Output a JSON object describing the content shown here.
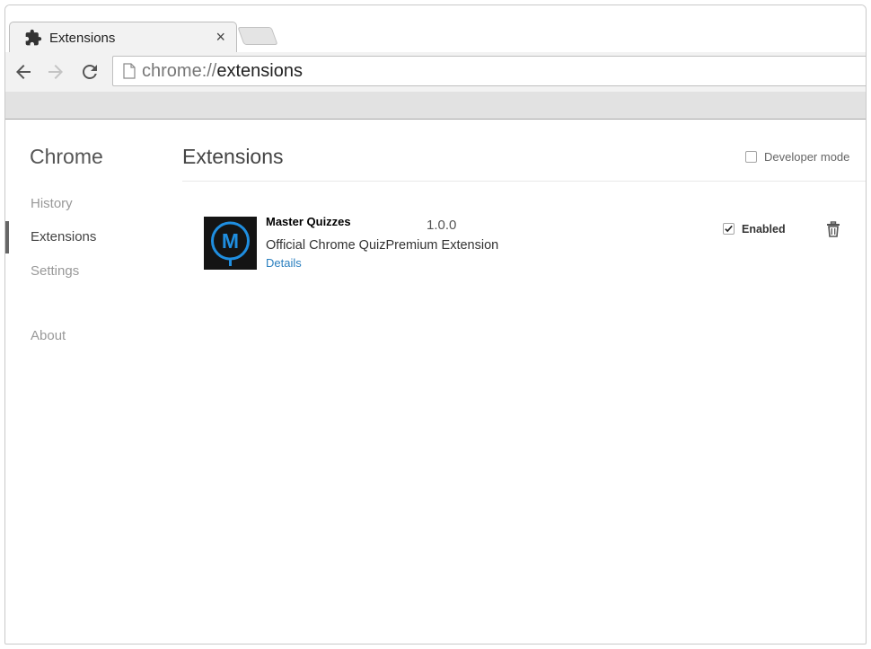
{
  "tab": {
    "title": "Extensions",
    "icon": "puzzle-piece-icon",
    "close_glyph": "×"
  },
  "toolbar": {
    "back_icon": "arrow-left-icon",
    "forward_icon": "arrow-right-icon",
    "reload_icon": "reload-icon",
    "url_scheme": "chrome://",
    "url_path": "extensions"
  },
  "sidebar": {
    "title": "Chrome",
    "items": [
      {
        "label": "History"
      },
      {
        "label": "Extensions"
      },
      {
        "label": "Settings"
      },
      {
        "label": "About"
      }
    ]
  },
  "main": {
    "title": "Extensions",
    "developer_mode_label": "Developer mode"
  },
  "extension": {
    "name": "Master Quizzes",
    "version": "1.0.0",
    "description": "Official Chrome QuizPremium Extension",
    "details_label": "Details",
    "enabled_label": "Enabled",
    "logo_letter": "M"
  },
  "colors": {
    "logo_ring": "#1f8ee0",
    "link": "#2a7fbf"
  }
}
